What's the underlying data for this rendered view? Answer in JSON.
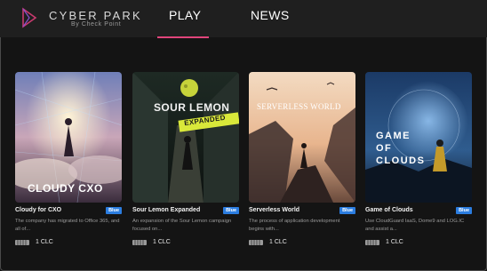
{
  "header": {
    "brand": "CYBER PARK",
    "brand_sub": "By Check Point",
    "nav": {
      "play": "PLAY",
      "news": "NEWS"
    },
    "accent": "#e0457b"
  },
  "cards": [
    {
      "title": "Cloudy for CXO",
      "badge": "Blue",
      "description": "The company has migrated to Office 365, and all of...",
      "cost": "1 CLC",
      "art_text": "CLOUDY CXO"
    },
    {
      "title": "Sour Lemon Expanded",
      "badge": "Blue",
      "description": "An expansion of the Sour Lemon campaign focused on...",
      "cost": "1 CLC",
      "art_text": "SOUR LEMON",
      "art_text2": "EXPANDED"
    },
    {
      "title": "Serverless World",
      "badge": "Blue",
      "description": "The process of application development begins with...",
      "cost": "1 CLC",
      "art_text": "SERVERLESS WORLD"
    },
    {
      "title": "Game of Clouds",
      "badge": "Blue",
      "description": "Use CloudGuard IaaS, Dome9 and LOG.IC and assist a...",
      "cost": "1 CLC",
      "art_text": "GAME",
      "art_text2": "OF",
      "art_text3": "CLOUDS"
    }
  ],
  "icons": {
    "logo": "triangle-logo-icon",
    "ticket": "ticket-icon"
  },
  "colors": {
    "badge": "#2b7de0",
    "background": "#141414",
    "header": "#1f1f1f"
  }
}
